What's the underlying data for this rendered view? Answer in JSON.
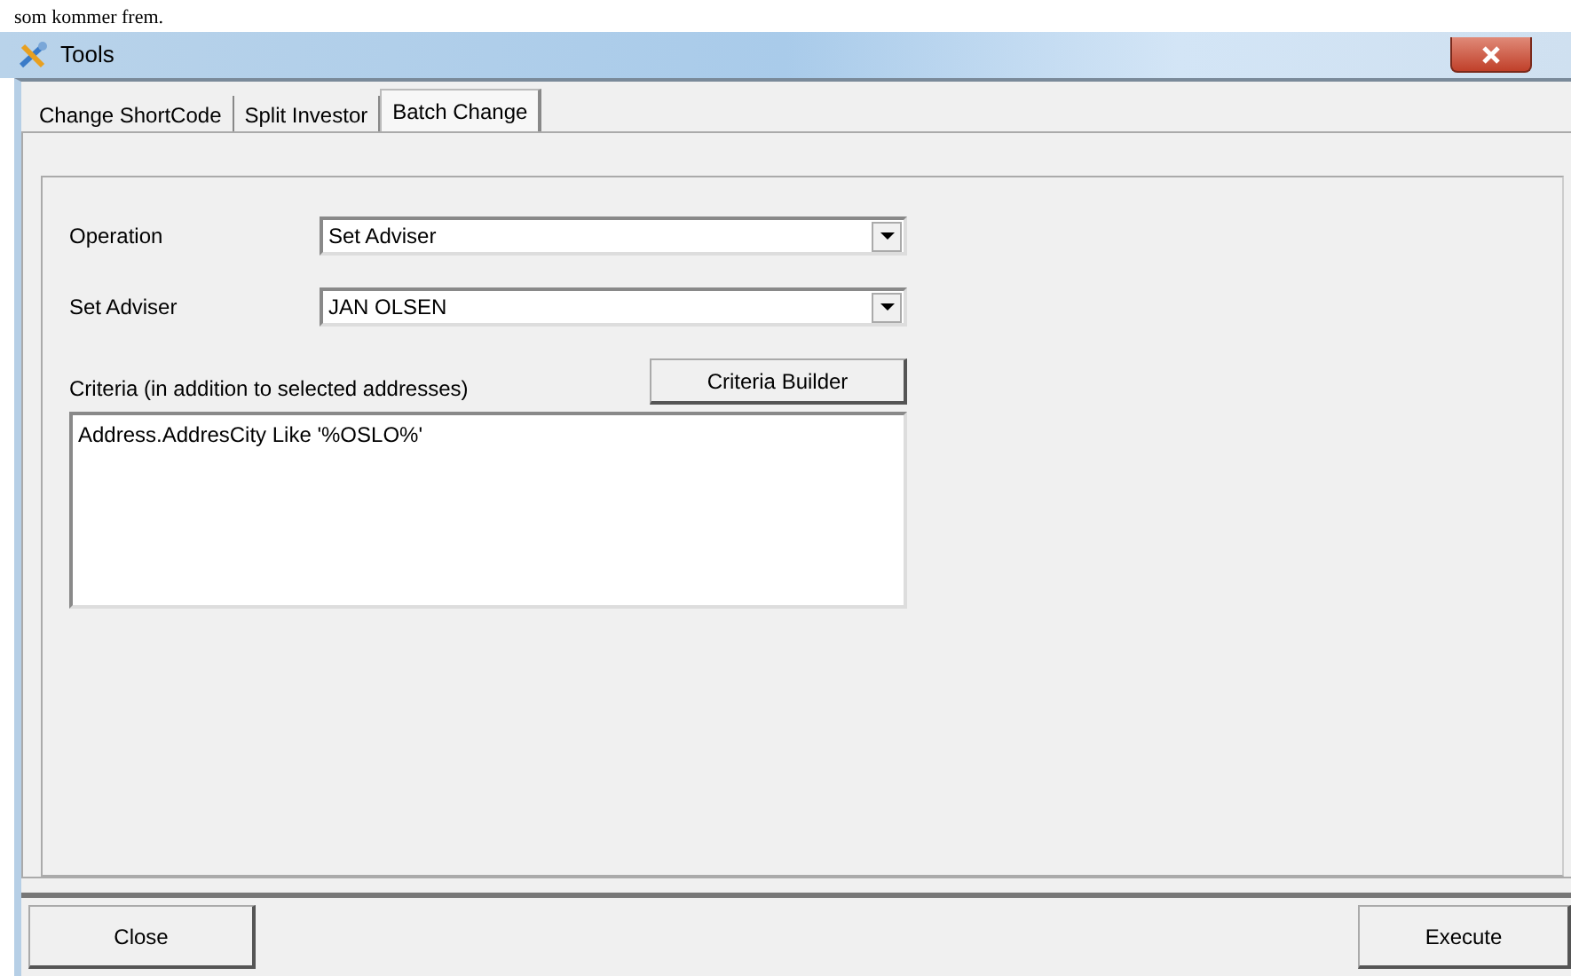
{
  "page_text": "som kommer frem.",
  "window": {
    "title": "Tools"
  },
  "tabs": [
    {
      "label": "Change ShortCode",
      "selected": false
    },
    {
      "label": "Split Investor",
      "selected": false
    },
    {
      "label": "Batch Change",
      "selected": true
    }
  ],
  "fields": [
    {
      "label": "Operation",
      "value": "Set Adviser"
    },
    {
      "label": "Set Adviser",
      "value": "JAN OLSEN"
    }
  ],
  "criteria": {
    "label": "Criteria (in addition to selected addresses)",
    "button": "Criteria Builder",
    "value": "Address.AddresCity Like '%OSLO%'"
  },
  "buttons": [
    {
      "label": "Close"
    },
    {
      "label": "Execute"
    }
  ]
}
